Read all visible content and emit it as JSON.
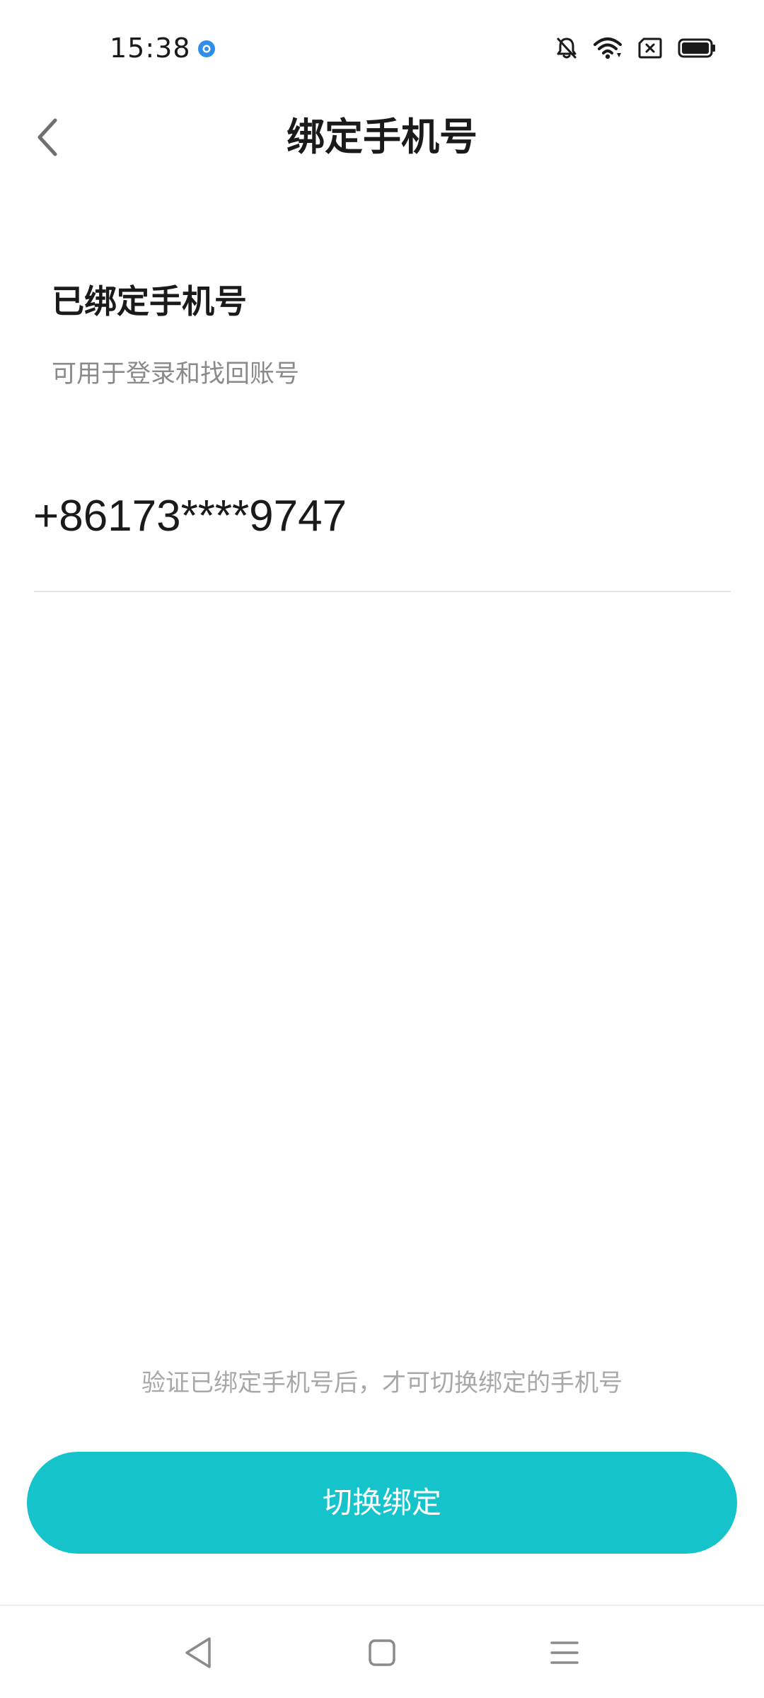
{
  "status_bar": {
    "time": "15:38",
    "icons": [
      "location-dot-icon",
      "bell-off-icon",
      "wifi-icon",
      "sim-off-icon",
      "battery-icon"
    ]
  },
  "header": {
    "title": "绑定手机号",
    "back_icon": "chevron-left-icon"
  },
  "content": {
    "section_title": "已绑定手机号",
    "section_subtitle": "可用于登录和找回账号",
    "phone_number": "+86173****9747"
  },
  "footer": {
    "hint": "验证已绑定手机号后，才可切换绑定的手机号",
    "switch_button_label": "切换绑定"
  },
  "system_nav": {
    "icons": [
      "nav-back-icon",
      "nav-home-icon",
      "nav-menu-icon"
    ]
  },
  "colors": {
    "accent": "#15c3cb",
    "text_primary": "#1a1a1a",
    "text_secondary": "#8a8a8a",
    "text_hint": "#a8a8a8",
    "divider": "#e3e3e3"
  }
}
